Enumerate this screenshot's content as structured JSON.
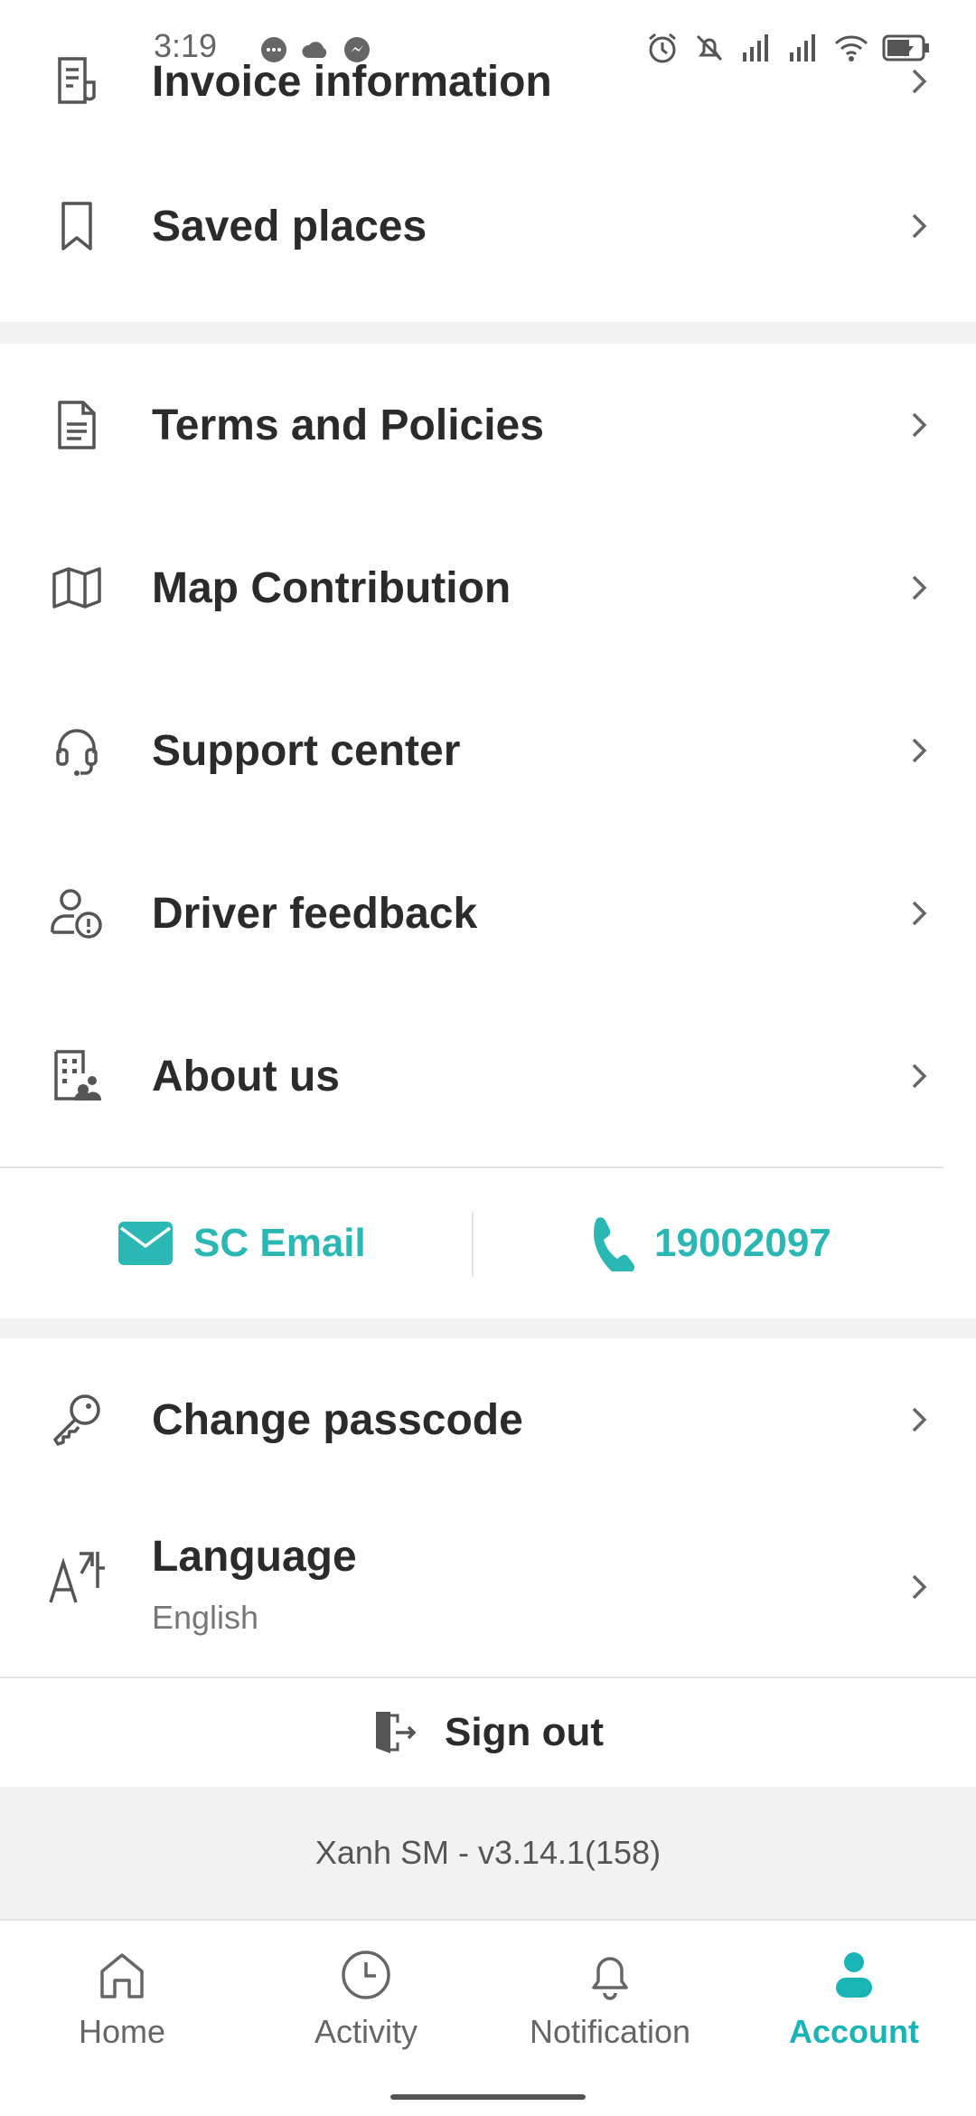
{
  "status_bar": {
    "time": "3:19",
    "left_icons": [
      "chat-bubble-icon",
      "cloud-icon",
      "messenger-icon"
    ],
    "right_icons": [
      "alarm-icon",
      "bell-off-icon",
      "signal-icon",
      "signal-icon",
      "wifi-icon",
      "battery-charging-icon"
    ]
  },
  "menu_group_1": [
    {
      "label": "Invoice information",
      "icon": "invoice-icon"
    },
    {
      "label": "Saved places",
      "icon": "bookmark-icon"
    }
  ],
  "menu_group_2": [
    {
      "label": "Terms and Policies",
      "icon": "document-icon"
    },
    {
      "label": "Map Contribution",
      "icon": "map-icon"
    },
    {
      "label": "Support center",
      "icon": "headset-icon"
    },
    {
      "label": "Driver feedback",
      "icon": "user-alert-icon"
    },
    {
      "label": "About us",
      "icon": "building-people-icon"
    }
  ],
  "contacts": {
    "email_label": "SC Email",
    "phone_label": "19002097",
    "accent_color": "#2bb8b4"
  },
  "menu_group_3": [
    {
      "label": "Change passcode",
      "icon": "key-icon"
    },
    {
      "label": "Language",
      "icon": "language-icon",
      "sub": "English"
    }
  ],
  "sign_out_label": "Sign out",
  "version": "Xanh SM - v3.14.1(158)",
  "bottom_nav": [
    {
      "label": "Home",
      "icon": "home-icon",
      "active": false
    },
    {
      "label": "Activity",
      "icon": "clock-icon",
      "active": false
    },
    {
      "label": "Notification",
      "icon": "bell-icon",
      "active": false
    },
    {
      "label": "Account",
      "icon": "account-icon",
      "active": true
    }
  ],
  "active_color": "#19b4b6"
}
